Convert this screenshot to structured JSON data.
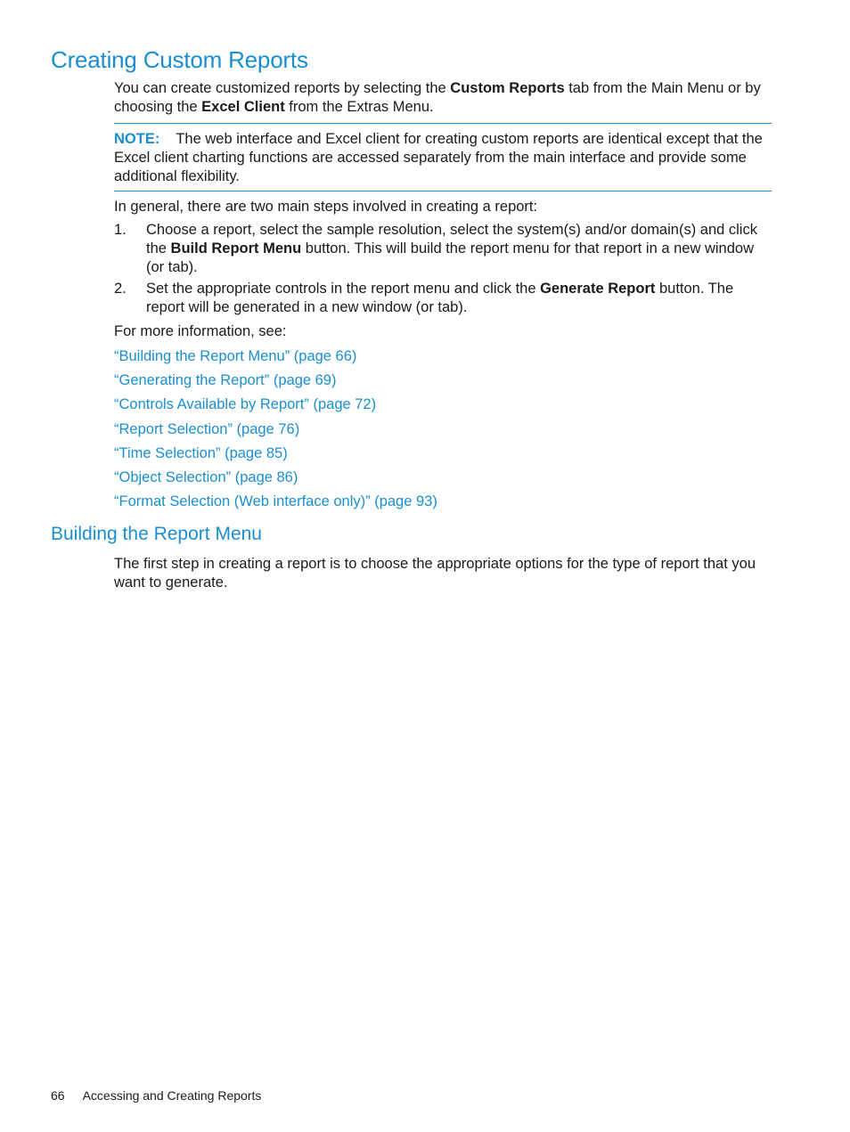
{
  "heading": "Creating Custom Reports",
  "intro": {
    "part1": "You can create customized reports by selecting the ",
    "bold1": "Custom Reports",
    "part2": " tab from the Main Menu or by choosing the ",
    "bold2": "Excel Client",
    "part3": " from the Extras Menu."
  },
  "note": {
    "label": "NOTE:",
    "text": "The web interface and Excel client for creating custom reports are identical except that the Excel client charting functions are accessed separately from the main interface and provide some additional flexibility."
  },
  "general": "In general, there are two main steps involved in creating a report:",
  "steps": [
    {
      "num": "1.",
      "part1": "Choose a report, select the sample resolution, select the system(s) and/or domain(s) and click the ",
      "bold": "Build Report Menu",
      "part2": " button. This will build the report menu for that report in a new window (or tab)."
    },
    {
      "num": "2.",
      "part1": "Set the appropriate controls in the report menu and click the ",
      "bold": "Generate Report",
      "part2": " button. The report will be generated in a new window (or tab)."
    }
  ],
  "more_info": "For more information, see:",
  "links": [
    "“Building the Report Menu” (page 66)",
    "“Generating the Report” (page 69)",
    "“Controls Available by Report” (page 72)",
    "“Report Selection” (page 76)",
    "“Time Selection” (page 85)",
    "“Object Selection” (page 86)",
    "“Format Selection (Web interface only)” (page 93)"
  ],
  "subheading": "Building the Report Menu",
  "sub_text": "The first step in creating a report is to choose the appropriate options for the type of report that you want to generate.",
  "footer": {
    "page_number": "66",
    "section": "Accessing and Creating Reports"
  },
  "colors": {
    "accent": "#1a8fd0",
    "text": "#1a1a1a"
  }
}
